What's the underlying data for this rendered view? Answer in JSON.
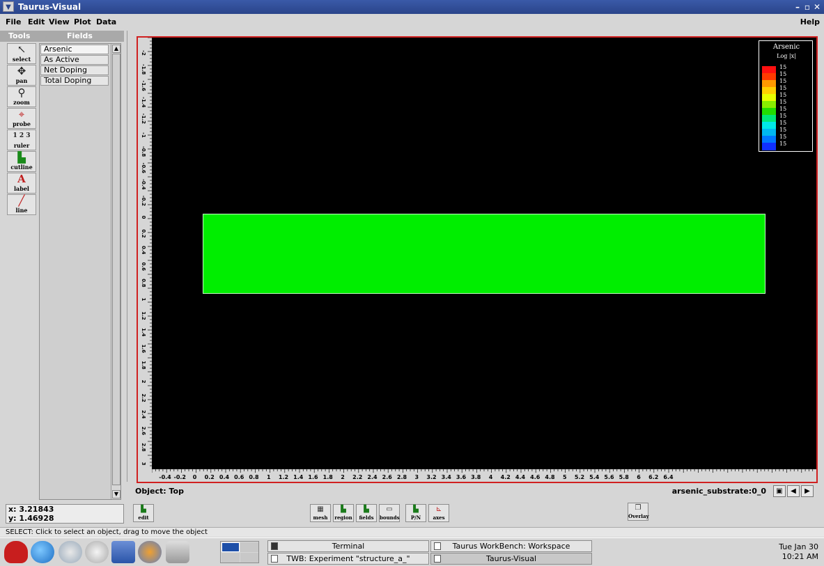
{
  "window": {
    "title": "Taurus-Visual"
  },
  "menu": {
    "items": [
      "File",
      "Edit",
      "View",
      "Plot",
      "Data"
    ],
    "help": "Help"
  },
  "panels": {
    "tools_header": "Tools",
    "fields_header": "Fields"
  },
  "tools": [
    {
      "name": "select",
      "icon": "arrow-icon"
    },
    {
      "name": "pan",
      "icon": "pan-icon"
    },
    {
      "name": "zoom",
      "icon": "magnifier-icon"
    },
    {
      "name": "probe",
      "icon": "crosshair-icon"
    },
    {
      "name": "ruler",
      "icon": "ruler-icon",
      "glyph": "1 2 3"
    },
    {
      "name": "cutline",
      "icon": "cutline-icon"
    },
    {
      "name": "label",
      "icon": "label-icon",
      "glyph": "A"
    },
    {
      "name": "line",
      "icon": "line-icon"
    }
  ],
  "fields": [
    "Arsenic",
    "As Active",
    "Net Doping",
    "Total Doping"
  ],
  "selected_field": "Arsenic",
  "plot": {
    "x_ticks": [
      "-0.4",
      "-0.2",
      "0",
      "0.2",
      "0.4",
      "0.6",
      "0.8",
      "1",
      "1.2",
      "1.4",
      "1.6",
      "1.8",
      "2",
      "2.2",
      "2.4",
      "2.6",
      "2.8",
      "3",
      "3.2",
      "3.4",
      "3.6",
      "3.8",
      "4",
      "4.2",
      "4.4",
      "4.6",
      "4.8",
      "5",
      "5.2",
      "5.4",
      "5.6",
      "5.8",
      "6",
      "6.2",
      "6.4"
    ],
    "y_ticks": [
      "-2",
      "-1.8",
      "-1.6",
      "-1.4",
      "-1.2",
      "-1",
      "-0.8",
      "-0.6",
      "-0.4",
      "-0.2",
      "0",
      "0.2",
      "0.4",
      "0.6",
      "0.8",
      "1",
      "1.2",
      "1.4",
      "1.6",
      "1.8",
      "2",
      "2.2",
      "2.4",
      "2.6",
      "2.8",
      "3"
    ],
    "region_color": "#00ee00",
    "background": "#000000",
    "frame_color": "#d02020"
  },
  "legend": {
    "title": "Arsenic",
    "scale": "Log |x|",
    "levels": [
      "15",
      "15",
      "15",
      "15",
      "15",
      "15",
      "15",
      "15",
      "15",
      "15",
      "15",
      "15"
    ],
    "colors": [
      "#ff1010",
      "#ff3a00",
      "#ff9900",
      "#ffd000",
      "#e8ff00",
      "#88ee00",
      "#22dd00",
      "#00e878",
      "#00e8e8",
      "#00b8f0",
      "#0078ff",
      "#1030ff"
    ]
  },
  "object_bar": {
    "object": "Object: Top",
    "substrate": "arsenic_substrate:0_0"
  },
  "coords": {
    "x": "x:  3.21843",
    "y": "y:  1.46928"
  },
  "buttons": {
    "edit": "edit",
    "mesh": "mesh",
    "region": "region",
    "fields": "fields",
    "bounds": "bounds",
    "pn": "P/N",
    "axes": "axes",
    "overlay": "Overlay"
  },
  "status": "SELECT: Click to select an object, drag to move the object",
  "taskbar": {
    "tasks": [
      {
        "label": "Terminal"
      },
      {
        "label": "Taurus WorkBench: Workspace"
      },
      {
        "label": "TWB: Experiment \"structure_a_\""
      },
      {
        "label": "Taurus-Visual"
      }
    ],
    "clock_date": "Tue Jan 30",
    "clock_time": "10:21 AM"
  }
}
